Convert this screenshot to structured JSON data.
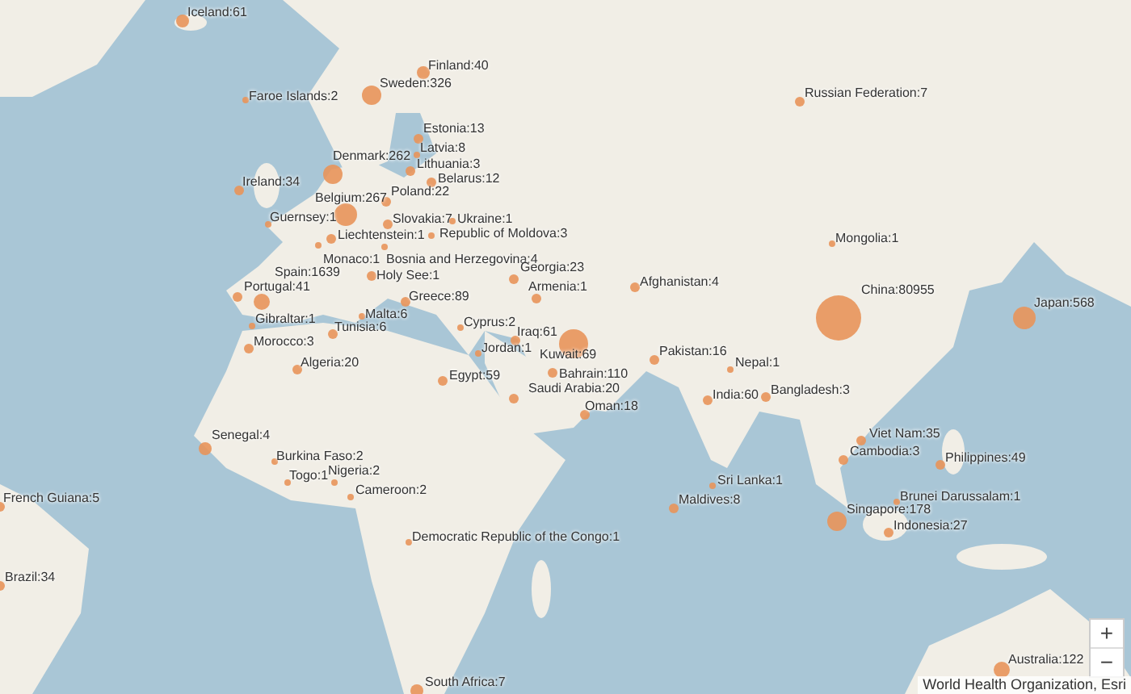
{
  "markers": [
    {
      "label": "Iceland:61"
    },
    {
      "label": "Faroe Islands:2"
    },
    {
      "label": "Finland:40"
    },
    {
      "label": "Sweden:326"
    },
    {
      "label": "Estonia:13"
    },
    {
      "label": "Latvia:8"
    },
    {
      "label": "Lithuania:3"
    },
    {
      "label": "Denmark:262"
    },
    {
      "label": "Belarus:12"
    },
    {
      "label": "Ireland:34"
    },
    {
      "label": "Poland:22"
    },
    {
      "label": "Belgium:267"
    },
    {
      "label": "Guernsey:1"
    },
    {
      "label": "Slovakia:7"
    },
    {
      "label": "Ukraine:1"
    },
    {
      "label": "Liechtenstein:1"
    },
    {
      "label": "Republic of Moldova:3"
    },
    {
      "label": "Monaco:1"
    },
    {
      "label": "Bosnia and Herzegovina:4"
    },
    {
      "label": "Spain:1639"
    },
    {
      "label": "Holy See:1"
    },
    {
      "label": "Georgia:23"
    },
    {
      "label": "Portugal:41"
    },
    {
      "label": "Armenia:1"
    },
    {
      "label": "Greece:89"
    },
    {
      "label": "Malta:6"
    },
    {
      "label": "Gibraltar:1"
    },
    {
      "label": "Tunisia:6"
    },
    {
      "label": "Cyprus:2"
    },
    {
      "label": "Iraq:61"
    },
    {
      "label": "Morocco:3"
    },
    {
      "label": "Jordan:1"
    },
    {
      "label": "Kuwait:69"
    },
    {
      "label": "Algeria:20"
    },
    {
      "label": "Bahrain:110"
    },
    {
      "label": "Egypt:59"
    },
    {
      "label": "Saudi Arabia:20"
    },
    {
      "label": "Oman:18"
    },
    {
      "label": "Afghanistan:4"
    },
    {
      "label": "Pakistan:16"
    },
    {
      "label": "Nepal:1"
    },
    {
      "label": "India:60"
    },
    {
      "label": "Bangladesh:3"
    },
    {
      "label": "China:80955"
    },
    {
      "label": "Japan:568"
    },
    {
      "label": "Russian Federation:7"
    },
    {
      "label": "Mongolia:1"
    },
    {
      "label": "Viet Nam:35"
    },
    {
      "label": "Cambodia:3"
    },
    {
      "label": "Philippines:49"
    },
    {
      "label": "Sri Lanka:1"
    },
    {
      "label": "Maldives:8"
    },
    {
      "label": "Brunei Darussalam:1"
    },
    {
      "label": "Singapore:178"
    },
    {
      "label": "Indonesia:27"
    },
    {
      "label": "Australia:122"
    },
    {
      "label": "Senegal:4"
    },
    {
      "label": "Burkina Faso:2"
    },
    {
      "label": "Togo:1"
    },
    {
      "label": "Nigeria:2"
    },
    {
      "label": "Cameroon:2"
    },
    {
      "label": "French Guiana:5"
    },
    {
      "label": "Democratic Republic of the Congo:1"
    },
    {
      "label": "Brazil:34"
    },
    {
      "label": "South Africa:7"
    }
  ],
  "zoom_controls": [
    {
      "kind": "zoom-in",
      "label": "+"
    },
    {
      "kind": "zoom-out",
      "label": "−"
    }
  ],
  "attribution": "World Health Organization, Esri"
}
